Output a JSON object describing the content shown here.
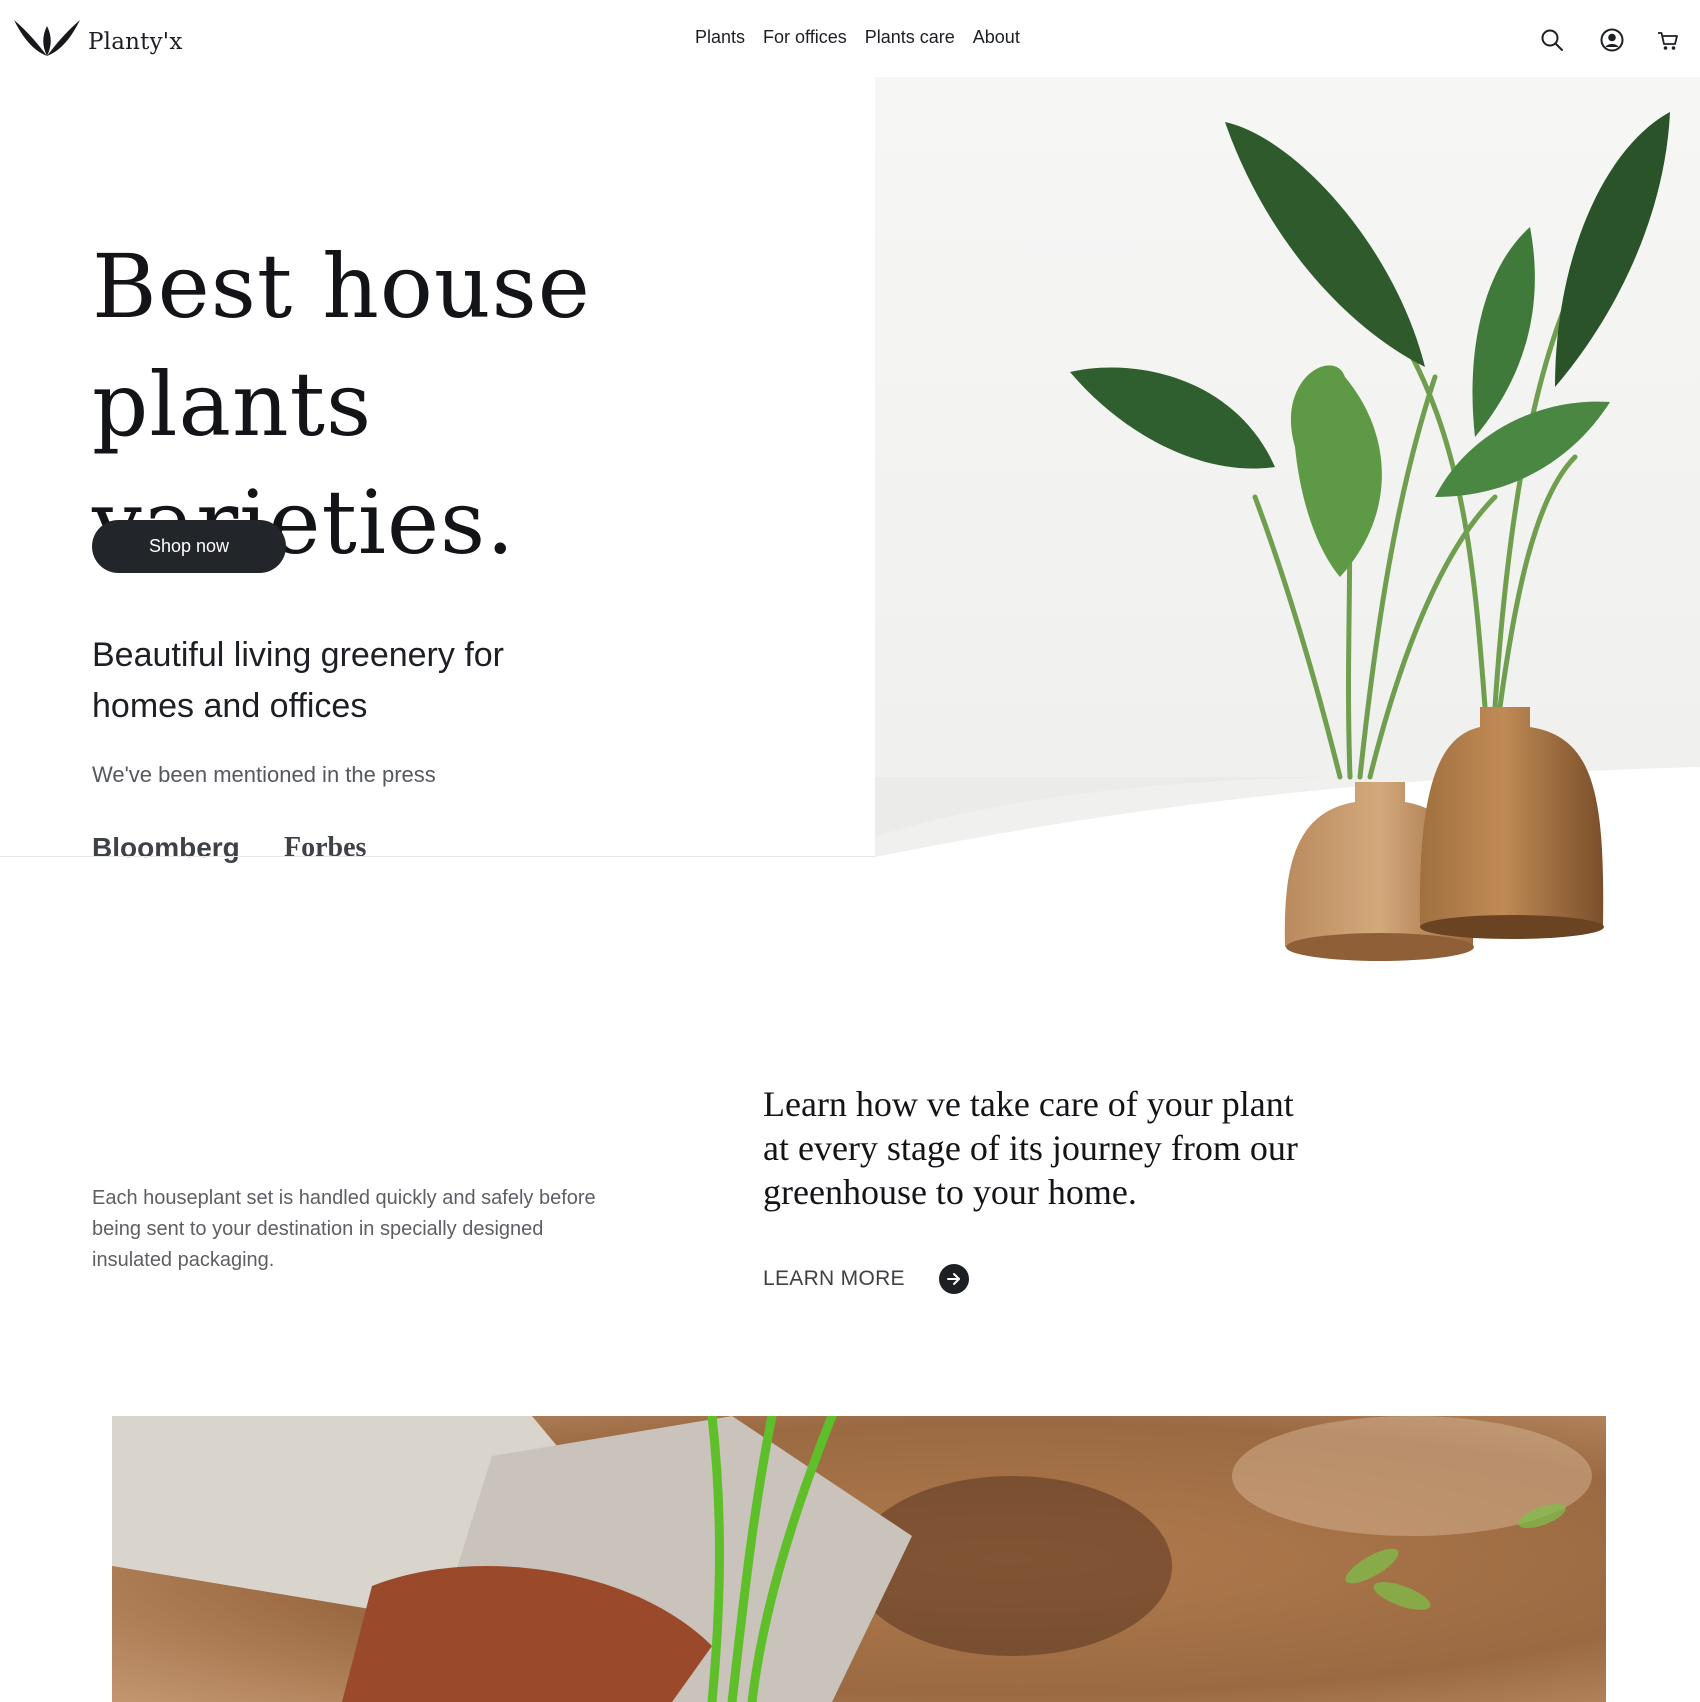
{
  "brand": {
    "name": "Planty'x",
    "logo_icon": "leaf-logo-icon"
  },
  "nav": {
    "items": [
      {
        "label": "Plants"
      },
      {
        "label": "For offices"
      },
      {
        "label": "Plants care"
      },
      {
        "label": "About"
      }
    ]
  },
  "header_tools": {
    "icons": [
      "search-icon",
      "account-icon",
      "cart-icon"
    ]
  },
  "hero": {
    "title_line1": "Best house",
    "title_line2": "plants varieties.",
    "cta_label": "Shop now",
    "subtitle": "Beautiful living greenery for homes and offices",
    "press_label": "We've been mentioned in the press",
    "press_logos": [
      "Bloomberg",
      "Forbes"
    ]
  },
  "care": {
    "description": "Each houseplant set is handled quickly and safely before being sent to your destination in specially designed insulated packaging.",
    "heading_line1": "Learn how ve take care of your plant",
    "heading_line2": "at every stage of its journey from our",
    "heading_line3": "greenhouse to your home.",
    "link_label": "LEARN MORE",
    "link_icon": "arrow-right-icon"
  },
  "colors": {
    "text_primary": "#121417",
    "button_dark": "#22252a",
    "muted_text": "#5c5f64",
    "leaf_green": "#3f7a3a",
    "wood_brown": "#9c6a3e"
  }
}
